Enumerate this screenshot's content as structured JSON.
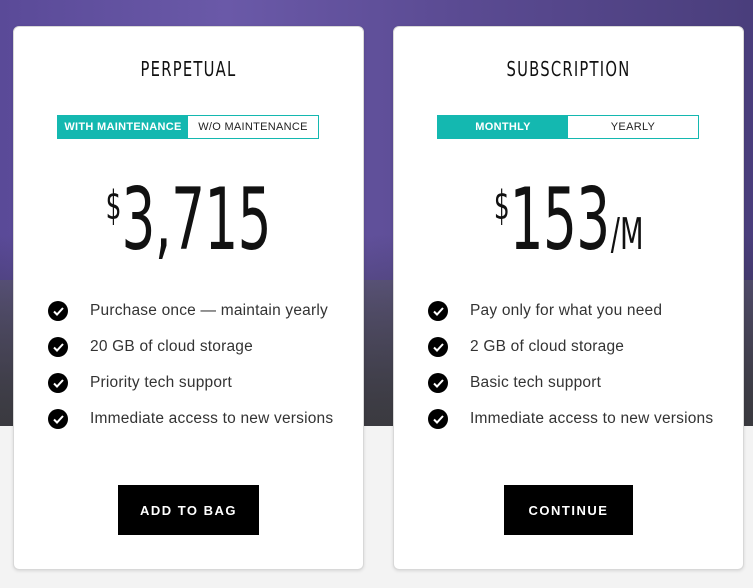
{
  "cards": [
    {
      "title": "PERPETUAL",
      "toggle": [
        {
          "label": "WITH MAINTENANCE",
          "active": true
        },
        {
          "label": "W/O MAINTENANCE",
          "active": false
        }
      ],
      "price": {
        "currency": "$",
        "amount": "3,715",
        "period": ""
      },
      "features": [
        "Purchase once — maintain yearly",
        "20 GB of cloud storage",
        "Priority tech support",
        "Immediate access to new versions"
      ],
      "button": "ADD TO BAG"
    },
    {
      "title": "SUBSCRIPTION",
      "toggle": [
        {
          "label": "MONTHLY",
          "active": true
        },
        {
          "label": "YEARLY",
          "active": false
        }
      ],
      "price": {
        "currency": "$",
        "amount": "153",
        "period": "/M"
      },
      "features": [
        "Pay only for what you need",
        "2 GB of cloud storage",
        "Basic tech support",
        "Immediate access to new versions"
      ],
      "button": "CONTINUE"
    }
  ],
  "colors": {
    "accent": "#14b8b0",
    "button_bg": "#000000",
    "check_bg": "#000000"
  },
  "icons": {
    "feature": "check-circle-icon"
  }
}
